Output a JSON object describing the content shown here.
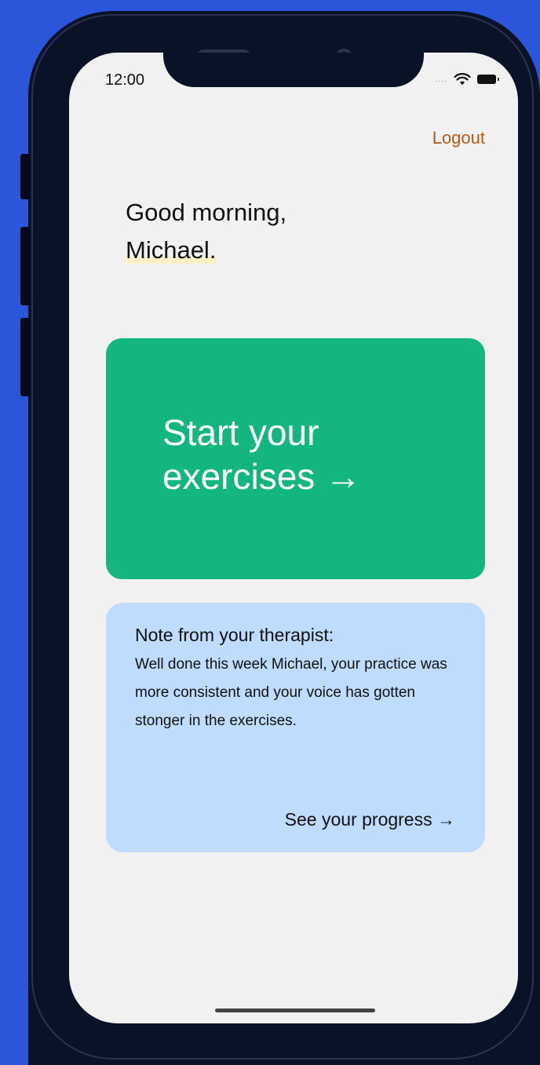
{
  "status_bar": {
    "time": "12:00",
    "signal_dots": "....",
    "wifi_icon": "wifi-icon",
    "battery_icon": "battery-icon"
  },
  "header": {
    "logout_label": "Logout"
  },
  "greeting": {
    "line1": "Good morning,",
    "name": "Michael."
  },
  "start_card": {
    "line1": "Start your",
    "line2": "exercises →"
  },
  "note_card": {
    "title": "Note from your therapist:",
    "body": "Well done this week Michael, your practice was more consistent and your voice has gotten stonger in the exercises.",
    "link": "See your progress →"
  },
  "colors": {
    "background": "#2c56d9",
    "device": "#0a1228",
    "screen": "#f1f1f1",
    "accent_green": "#12b67e",
    "note_blue": "#bfdbfd",
    "logout": "#b35a18",
    "highlight": "#fff1c7"
  }
}
